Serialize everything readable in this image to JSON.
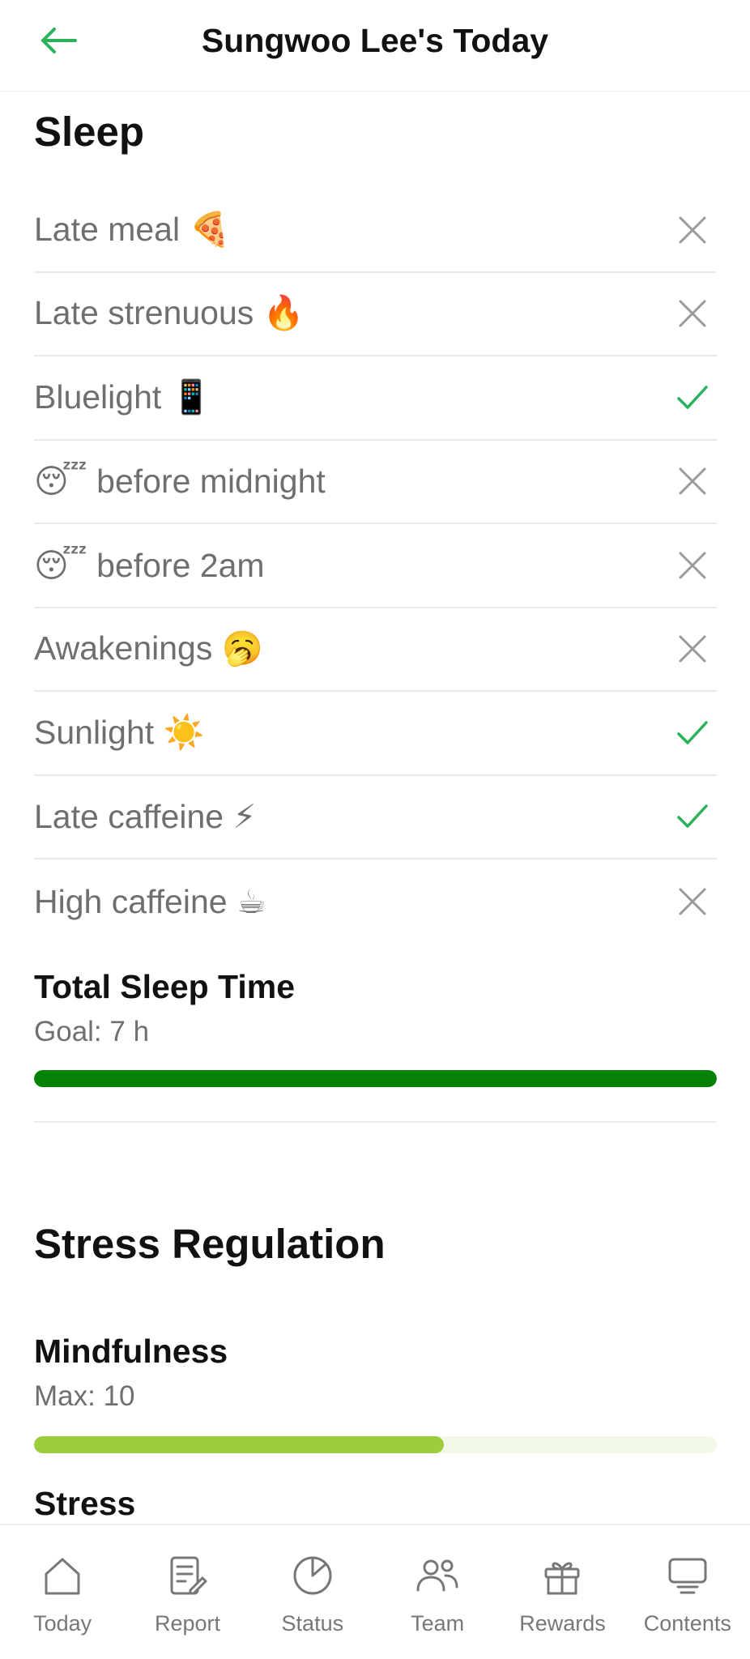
{
  "header": {
    "title": "Sungwoo Lee's Today",
    "back_icon": "arrow-left-icon",
    "accent": "#2ab25a"
  },
  "sleep": {
    "title": "Sleep",
    "habits": [
      {
        "label": "Late meal 🍕",
        "status": "cross"
      },
      {
        "label": "Late strenuous 🔥",
        "status": "cross"
      },
      {
        "label": "Bluelight 📱",
        "status": "check"
      },
      {
        "label": "😴 before midnight",
        "status": "cross"
      },
      {
        "label": "😴 before 2am",
        "status": "cross"
      },
      {
        "label": "Awakenings 🥱",
        "status": "cross"
      },
      {
        "label": "Sunlight ☀️",
        "status": "check"
      },
      {
        "label": "Late caffeine ⚡",
        "status": "check"
      },
      {
        "label": "High caffeine ☕",
        "status": "cross"
      }
    ],
    "total_sleep": {
      "title": "Total Sleep Time",
      "goal": "Goal: 7 h",
      "progress": 1.0,
      "color": "#058205"
    }
  },
  "stress": {
    "title": "Stress Regulation",
    "mindfulness": {
      "title": "Mindfulness",
      "max": "Max: 10",
      "progress": 0.6,
      "color": "#9dcd3b"
    },
    "stress_label": "Stress"
  },
  "tabs": [
    {
      "label": "Today",
      "icon": "home-icon"
    },
    {
      "label": "Report",
      "icon": "report-icon"
    },
    {
      "label": "Status",
      "icon": "pie-chart-icon"
    },
    {
      "label": "Team",
      "icon": "team-icon"
    },
    {
      "label": "Rewards",
      "icon": "gift-icon"
    },
    {
      "label": "Contents",
      "icon": "contents-icon"
    }
  ]
}
